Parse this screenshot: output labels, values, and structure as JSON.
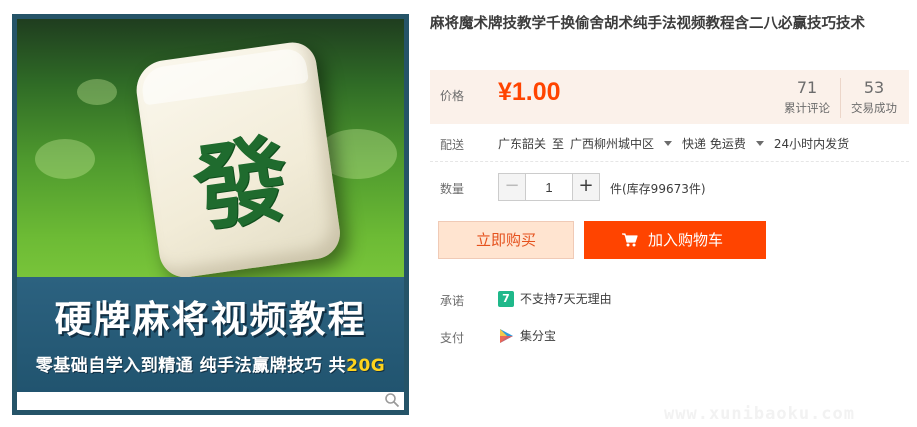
{
  "product": {
    "title": "麻将魔术牌技教学千换偷舍胡术纯手法视频教程含二八必赢技巧技术",
    "image": {
      "tile_glyph": "發",
      "banner_title": "硬牌麻将视频教程",
      "banner_sub_main": "零基础自学入到精通  纯手法赢牌技巧  共",
      "banner_sub_highlight": "20G"
    }
  },
  "price": {
    "label": "价格",
    "value": "¥1.00",
    "reviews_count": "71",
    "reviews_label": "累计评论",
    "sales_count": "53",
    "sales_label": "交易成功"
  },
  "shipping": {
    "label": "配送",
    "from": "广东韶关",
    "to_word": "至",
    "destination": "广西柳州城中区",
    "method": "快递 免运费",
    "dispatch": "24小时内发货"
  },
  "quantity": {
    "label": "数量",
    "value": "1",
    "minus": "−",
    "plus": "+",
    "stock_text": "件(库存99673件)"
  },
  "actions": {
    "buy_now": "立即购买",
    "add_to_cart": "加入购物车"
  },
  "promise": {
    "label": "承诺",
    "badge": "7",
    "text": "不支持7天无理由"
  },
  "payment": {
    "label": "支付",
    "text": "集分宝"
  },
  "watermark": "www.xunibaoku.com",
  "colors": {
    "accent": "#ff4400",
    "price_bg": "#fbf1ea",
    "banner_bg": "#255468"
  }
}
